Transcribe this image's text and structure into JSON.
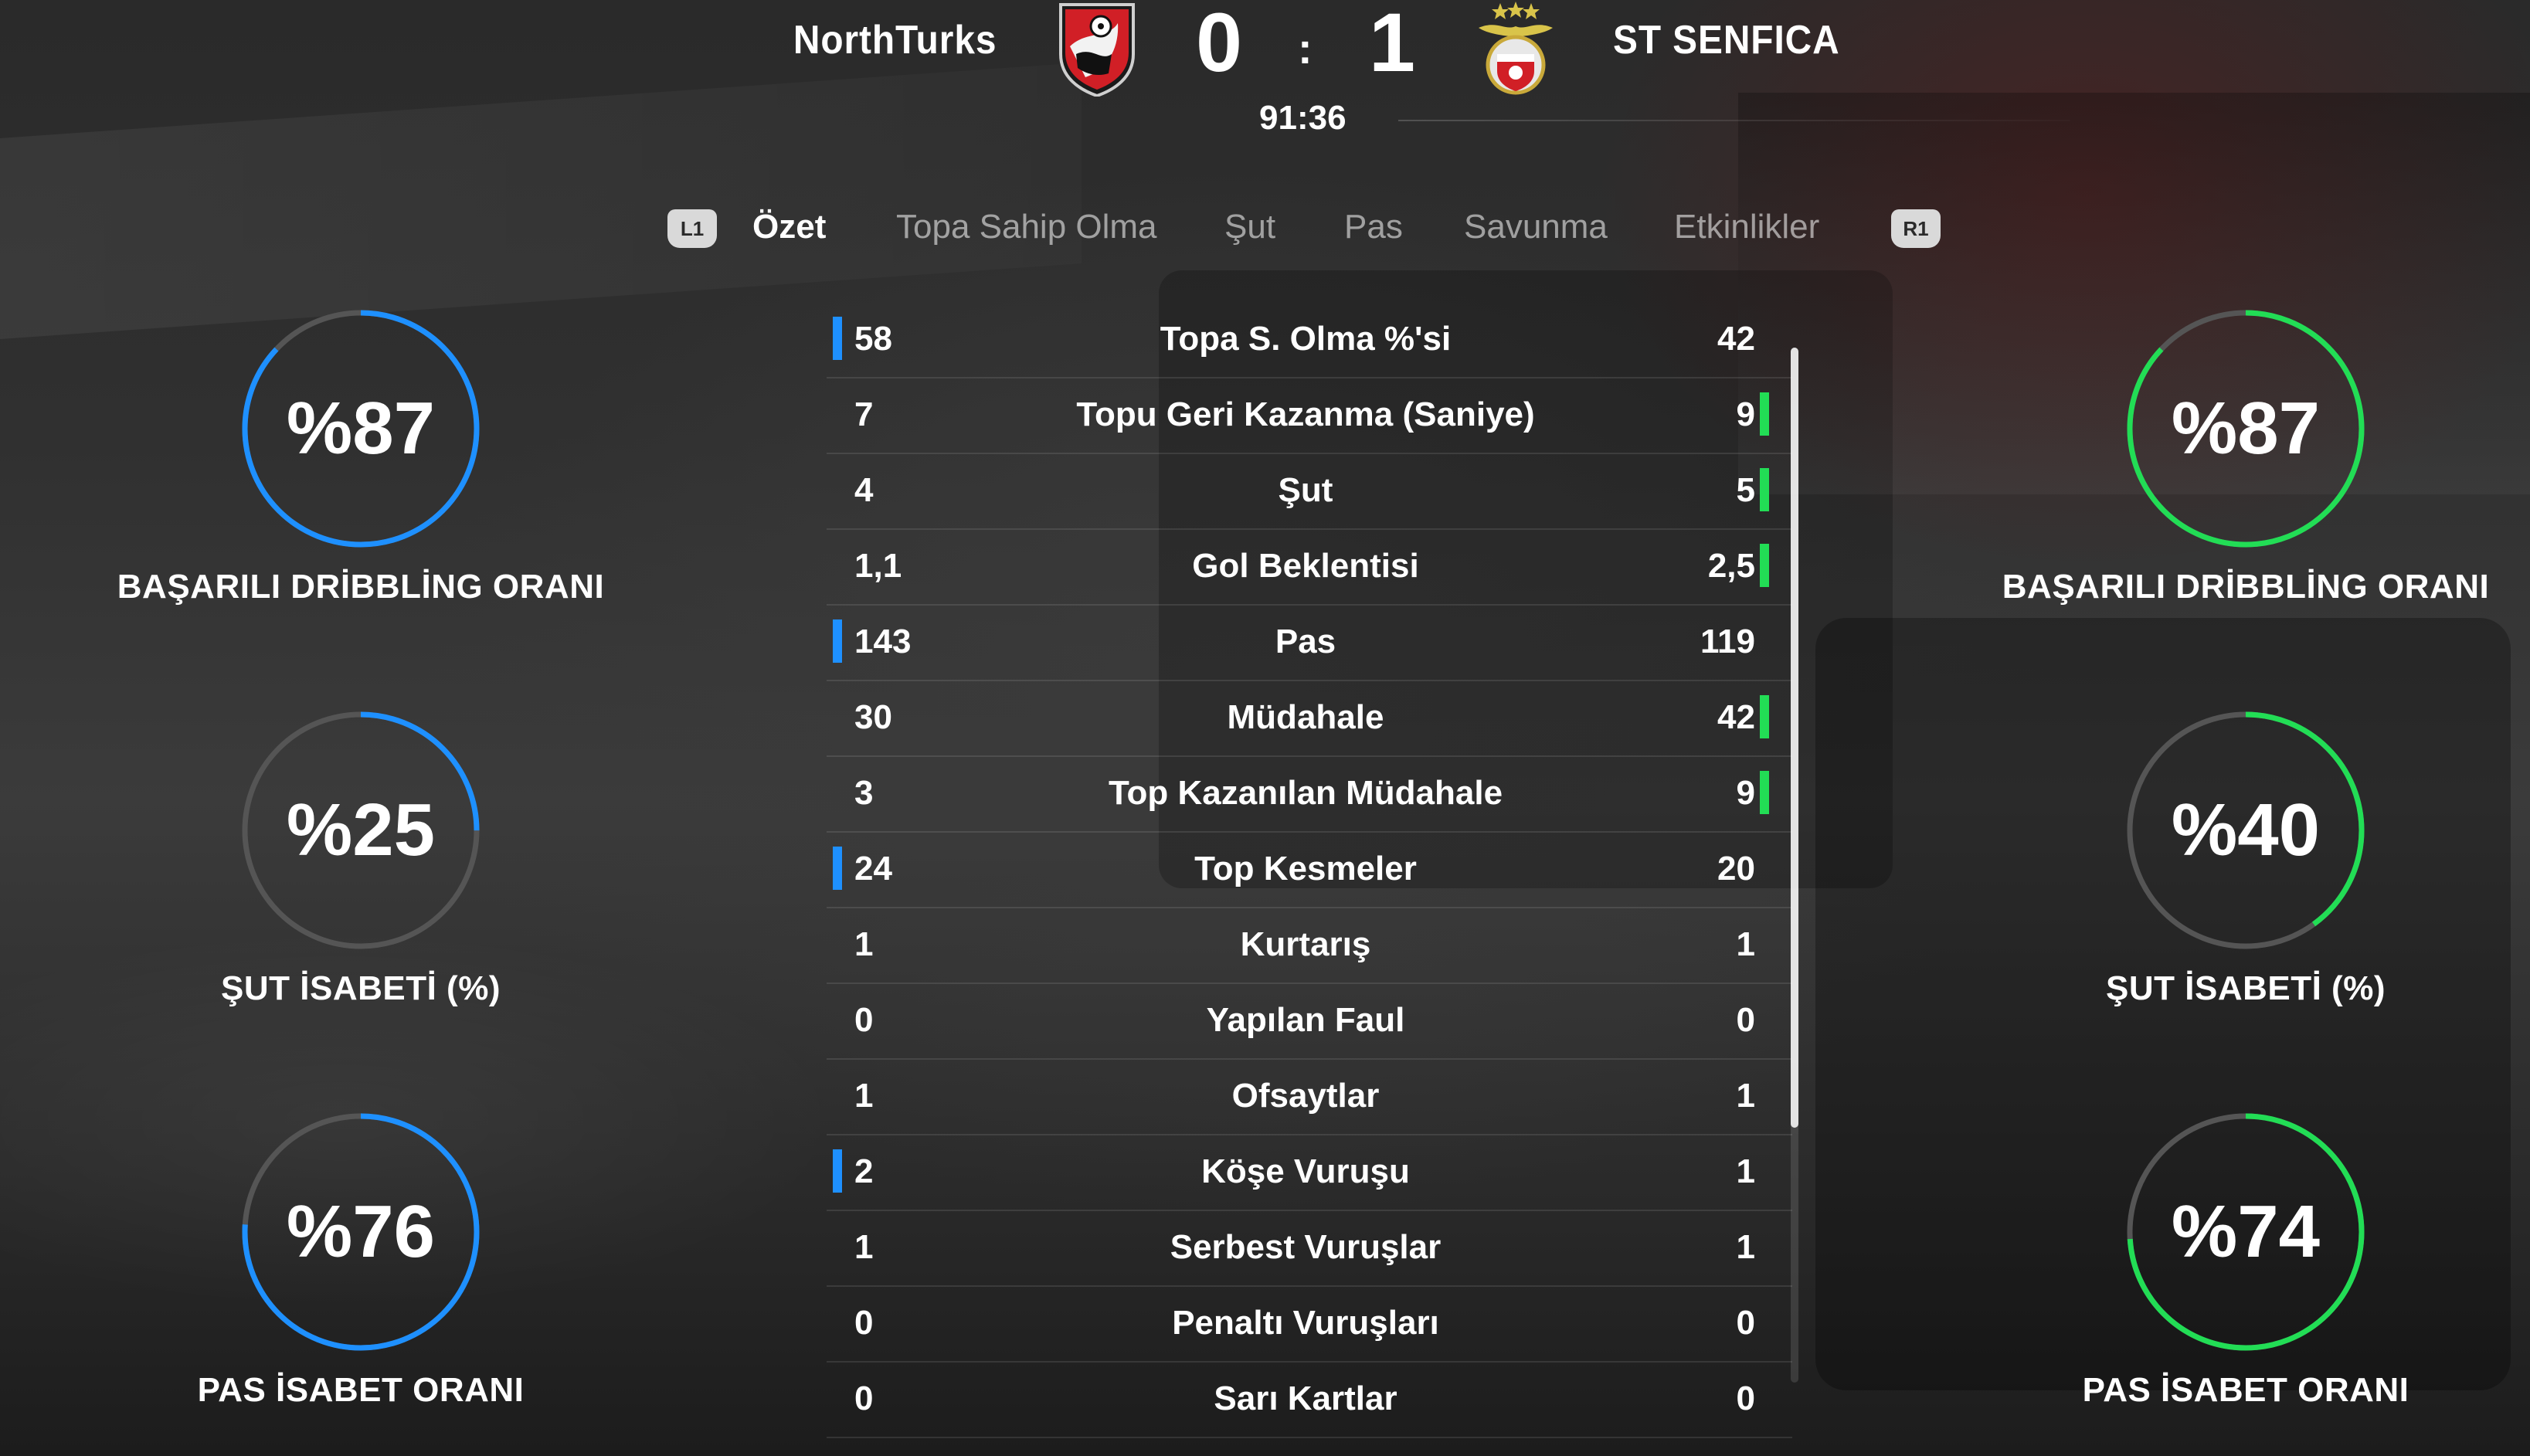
{
  "header": {
    "home_team": "NorthTurks",
    "away_team": "ST SENFICA",
    "home_score": "0",
    "score_separator": ":",
    "away_score": "1",
    "match_time": "91:36"
  },
  "tabs": {
    "left_shoulder": "L1",
    "right_shoulder": "R1",
    "items": [
      "Özet",
      "Topa Sahip Olma",
      "Şut",
      "Pas",
      "Savunma",
      "Etkinlikler"
    ],
    "active": "Özet"
  },
  "colors": {
    "home_accent": "#1e90ff",
    "away_accent": "#22dd55",
    "ring_track": "#555555"
  },
  "stats": [
    {
      "label": "Topa S. Olma %'si",
      "home": "58",
      "away": "42",
      "leader": "home"
    },
    {
      "label": "Topu Geri Kazanma (Saniye)",
      "home": "7",
      "away": "9",
      "leader": "away"
    },
    {
      "label": "Şut",
      "home": "4",
      "away": "5",
      "leader": "away"
    },
    {
      "label": "Gol Beklentisi",
      "home": "1,1",
      "away": "2,5",
      "leader": "away"
    },
    {
      "label": "Pas",
      "home": "143",
      "away": "119",
      "leader": "home"
    },
    {
      "label": "Müdahale",
      "home": "30",
      "away": "42",
      "leader": "away"
    },
    {
      "label": "Top Kazanılan Müdahale",
      "home": "3",
      "away": "9",
      "leader": "away"
    },
    {
      "label": "Top Kesmeler",
      "home": "24",
      "away": "20",
      "leader": "home"
    },
    {
      "label": "Kurtarış",
      "home": "1",
      "away": "1",
      "leader": "none"
    },
    {
      "label": "Yapılan Faul",
      "home": "0",
      "away": "0",
      "leader": "none"
    },
    {
      "label": "Ofsaytlar",
      "home": "1",
      "away": "1",
      "leader": "none"
    },
    {
      "label": "Köşe Vuruşu",
      "home": "2",
      "away": "1",
      "leader": "home"
    },
    {
      "label": "Serbest Vuruşlar",
      "home": "1",
      "away": "1",
      "leader": "none"
    },
    {
      "label": "Penaltı Vuruşları",
      "home": "0",
      "away": "0",
      "leader": "none"
    },
    {
      "label": "Sarı Kartlar",
      "home": "0",
      "away": "0",
      "leader": "none"
    }
  ],
  "rings": {
    "home": [
      {
        "value_text": "%87",
        "fraction": 0.87,
        "label": "BAŞARILI DRİBBLİNG ORANI"
      },
      {
        "value_text": "%25",
        "fraction": 0.25,
        "label": "ŞUT İSABETİ (%)"
      },
      {
        "value_text": "%76",
        "fraction": 0.76,
        "label": "PAS İSABET ORANI"
      }
    ],
    "away": [
      {
        "value_text": "%87",
        "fraction": 0.87,
        "label": "BAŞARILI DRİBBLİNG ORANI"
      },
      {
        "value_text": "%40",
        "fraction": 0.4,
        "label": "ŞUT İSABETİ (%)"
      },
      {
        "value_text": "%74",
        "fraction": 0.74,
        "label": "PAS İSABET ORANI"
      }
    ]
  }
}
